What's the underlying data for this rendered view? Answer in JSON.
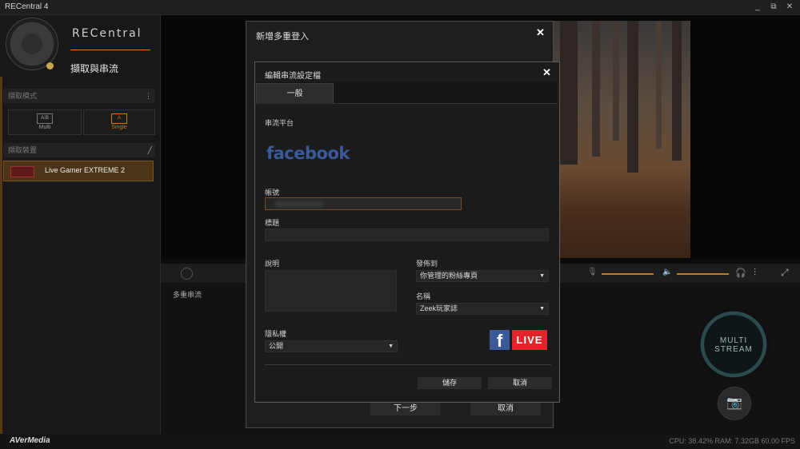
{
  "window": {
    "title": "RECentral 4"
  },
  "sidebar": {
    "brand": "RECentral",
    "subtitle": "擷取與串流",
    "mode_header": "擷取模式",
    "modes": [
      {
        "label": "Multi",
        "icon_text": "A⁞B"
      },
      {
        "label": "Single",
        "icon_text": "A"
      }
    ],
    "device_header": "擷取裝置",
    "device_name": "Live Gamer EXTREME 2",
    "footer_logo": "AVerMedia"
  },
  "lower": {
    "multi_stream_label": "多重串流"
  },
  "multi_stream_button": {
    "line1": "MULTI",
    "line2": "STREAM"
  },
  "status": {
    "stats": "CPU: 38.42%  RAM: 7.32GB  60.00 FPS"
  },
  "outer_dialog": {
    "title": "新增多重登入",
    "next_button": "下一步",
    "cancel_button": "取消"
  },
  "inner_dialog": {
    "title": "編輯串流設定檔",
    "tab_general": "一般",
    "platform_label": "串流平台",
    "platform_logo": "facebook",
    "account_label": "帳號",
    "account_value": "",
    "title_label": "標題",
    "title_value": "",
    "description_label": "說明",
    "publish_to_label": "發佈到",
    "publish_to_value": "你管理的粉絲專頁",
    "name_label": "名稱",
    "name_value": "Zeek玩家誌",
    "privacy_label": "隱私權",
    "privacy_value": "公開",
    "fb_live_badge": "LIVE",
    "save_button": "儲存",
    "cancel_button": "取消"
  },
  "icons": [
    "minimize-icon",
    "restore-icon",
    "close-icon",
    "more-icon",
    "edit-icon",
    "mic-icon",
    "speaker-icon",
    "headphone-icon",
    "mixer-icon",
    "fullscreen-icon",
    "camera-icon"
  ],
  "colors": {
    "accent": "#c47a1e",
    "facebook": "#3b5998",
    "live_red": "#e0262a"
  }
}
